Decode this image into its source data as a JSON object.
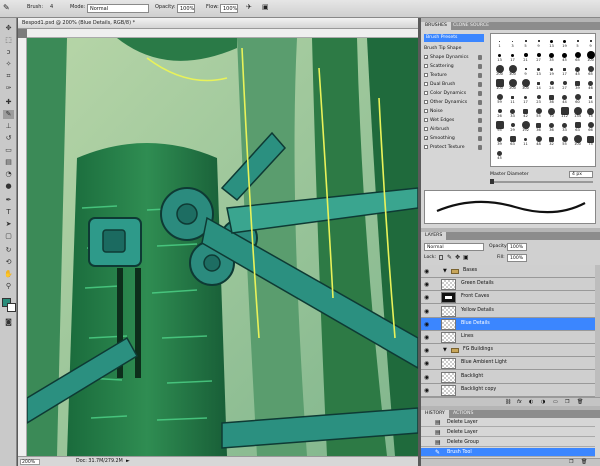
{
  "options_bar": {
    "brush_label": "Brush:",
    "brush_size": "4",
    "mode_label": "Mode:",
    "mode_value": "Normal",
    "opacity_label": "Opacity:",
    "opacity_value": "100%",
    "flow_label": "Flow:",
    "flow_value": "100%"
  },
  "document": {
    "title": "Bespod1.psd @ 200% (Blue Details, RGB/8) *",
    "zoom": "200%",
    "doc_info": "Doc: 31.7M/279.2M"
  },
  "brushes_panel": {
    "tabs": [
      "BRUSHES",
      "CLONE SOURCE"
    ],
    "presets_label": "Brush Presets",
    "items": [
      {
        "label": "Brush Tip Shape",
        "checkbox": false
      },
      {
        "label": "Shape Dynamics",
        "checkbox": true,
        "checked": true
      },
      {
        "label": "Scattering",
        "checkbox": true,
        "checked": false
      },
      {
        "label": "Texture",
        "checkbox": true,
        "checked": false
      },
      {
        "label": "Dual Brush",
        "checkbox": true,
        "checked": false
      },
      {
        "label": "Color Dynamics",
        "checkbox": true,
        "checked": false
      },
      {
        "label": "Other Dynamics",
        "checkbox": true,
        "checked": false
      },
      {
        "label": "Noise",
        "checkbox": true,
        "checked": false
      },
      {
        "label": "Wet Edges",
        "checkbox": true,
        "checked": false
      },
      {
        "label": "Airbrush",
        "checkbox": true,
        "checked": false
      },
      {
        "label": "Smoothing",
        "checkbox": true,
        "checked": true
      },
      {
        "label": "Protect Texture",
        "checkbox": true,
        "checked": false
      }
    ],
    "tip_numbers": [
      "1",
      "3",
      "5",
      "9",
      "13",
      "19",
      "5",
      "9",
      "13",
      "17",
      "21",
      "27",
      "35",
      "45",
      "65",
      "100",
      "200",
      "300",
      "9",
      "13",
      "19",
      "17",
      "45",
      "65",
      "100",
      "200",
      "300",
      "14",
      "24",
      "27",
      "39",
      "46",
      "59",
      "11",
      "17",
      "23",
      "36",
      "44",
      "60",
      "14",
      "26",
      "33",
      "42",
      "55",
      "70",
      "112",
      "134",
      "74",
      "95",
      "29",
      "192",
      "36",
      "36",
      "33",
      "63",
      "66",
      "39",
      "63",
      "11",
      "48",
      "32",
      "55",
      "100",
      "75",
      "45"
    ],
    "master_diameter_label": "Master Diameter",
    "master_diameter_value": "4 px"
  },
  "layers_panel": {
    "tab": "LAYERS",
    "blend_mode": "Normal",
    "opacity_label": "Opacity:",
    "opacity_value": "100%",
    "lock_label": "Lock:",
    "fill_label": "Fill:",
    "fill_value": "100%",
    "layers": [
      {
        "name": "Bases",
        "type": "group"
      },
      {
        "name": "Green Details",
        "type": "layer"
      },
      {
        "name": "Front Caves",
        "type": "layer"
      },
      {
        "name": "Yellow Details",
        "type": "layer"
      },
      {
        "name": "Blue Details",
        "type": "layer",
        "selected": true
      },
      {
        "name": "Lines",
        "type": "layer"
      },
      {
        "name": "FG Buildings",
        "type": "group"
      },
      {
        "name": "Blue Ambient Light",
        "type": "layer"
      },
      {
        "name": "Backlight",
        "type": "layer"
      },
      {
        "name": "Backlight copy",
        "type": "layer"
      }
    ]
  },
  "history_panel": {
    "tabs": [
      "HISTORY",
      "ACTIONS"
    ],
    "items": [
      {
        "label": "Delete Layer"
      },
      {
        "label": "Delete Layer"
      },
      {
        "label": "Delete Group"
      },
      {
        "label": "Brush Tool",
        "current": true
      }
    ]
  },
  "colors": {
    "accent": "#3b86ff",
    "foreground": "#2a8c7a",
    "background": "#ffffff"
  }
}
